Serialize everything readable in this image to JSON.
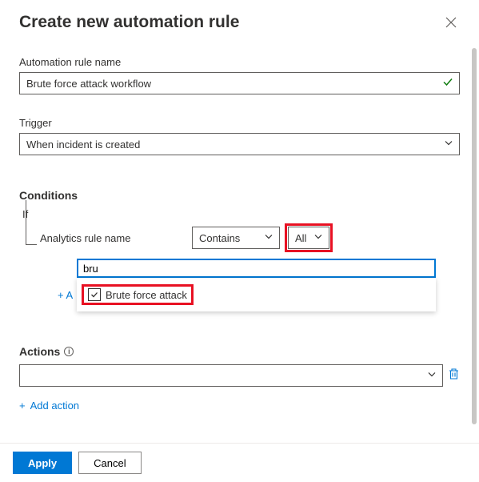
{
  "title": "Create new automation rule",
  "fields": {
    "rule_name_label": "Automation rule name",
    "rule_name_value": "Brute force attack workflow"
  },
  "trigger": {
    "label": "Trigger",
    "value": "When incident is created"
  },
  "conditions": {
    "heading": "Conditions",
    "if_label": "If",
    "field": "Analytics rule name",
    "operator": "Contains",
    "value_selected": "All",
    "search_value": "bru",
    "add_prefix": "+ A",
    "dropdown_item": "Brute force attack"
  },
  "actions": {
    "heading": "Actions",
    "add_label": "Add action",
    "add_plus": "+"
  },
  "footer": {
    "apply": "Apply",
    "cancel": "Cancel"
  }
}
